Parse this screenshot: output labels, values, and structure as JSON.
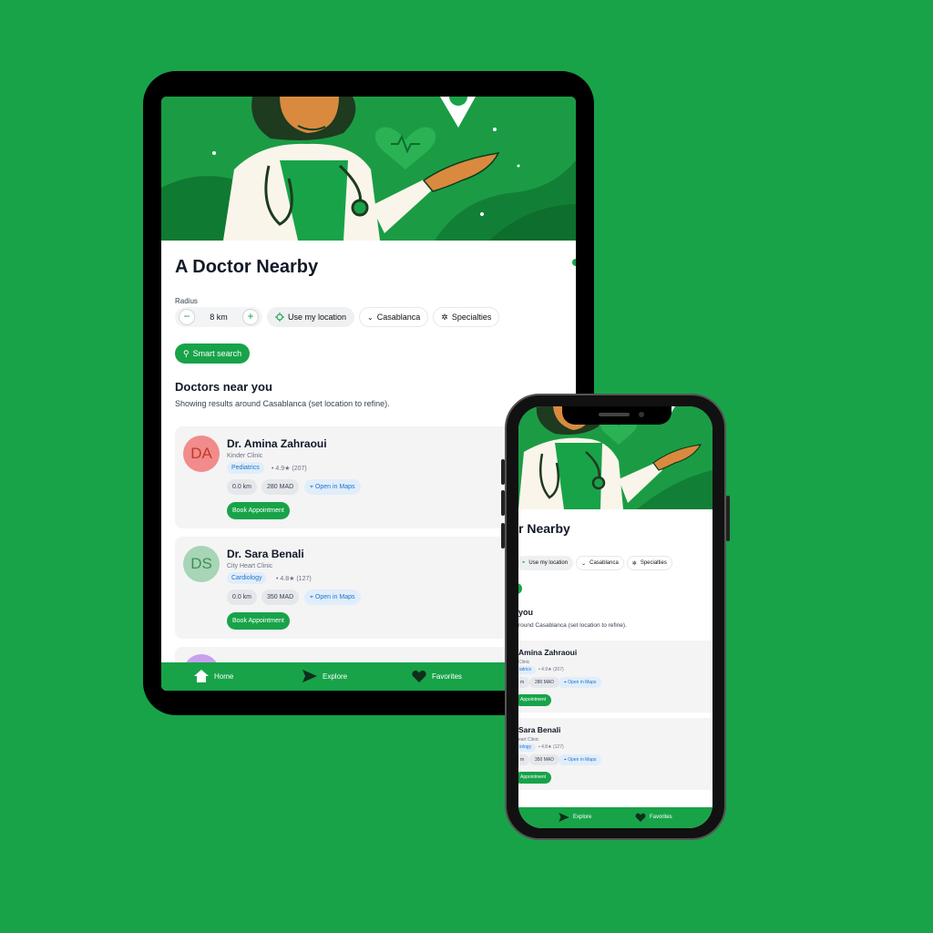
{
  "app": {
    "title": "A Doctor Nearby",
    "title_phone_visible": "r Nearby"
  },
  "filters": {
    "radius_label": "Radius",
    "radius_value": "8 km",
    "minus": "−",
    "plus": "+",
    "use_location": "Use my location",
    "city": "Casablanca",
    "specialties": "Specialties",
    "smart_search": "Smart search"
  },
  "section": {
    "title": "Doctors near you",
    "subtitle": "Showing results around Casablanca (set location to refine).",
    "title_phone_visible": "you",
    "subtitle_phone_visible": "round Casablanca (set location to refine)."
  },
  "doctors": [
    {
      "initials": "DA",
      "name": "Dr. Amina Zahraoui",
      "clinic": "Kinder Clinic",
      "specialty": "Pediatrics",
      "rating": "• 4.9★ (207)",
      "distance": "0.0 km",
      "price": "280 MAD",
      "maps": "Open in Maps",
      "book": "Book Appointment",
      "avatar_bg": "#f28b8b",
      "avatar_fg": "#c0392b",
      "phone_name": "Amina Zahraoui",
      "phone_clinic": "Clinic",
      "phone_specialty": "iatrics",
      "phone_rating": "• 4.9★ (207)",
      "phone_distance": "m",
      "phone_book": "Appointment"
    },
    {
      "initials": "DS",
      "name": "Dr. Sara Benali",
      "clinic": "City Heart Clinic",
      "specialty": "Cardiology",
      "rating": "• 4.8★ (127)",
      "distance": "0.0 km",
      "price": "350 MAD",
      "maps": "Open in Maps",
      "book": "Book Appointment",
      "avatar_bg": "#a8d5b5",
      "avatar_fg": "#3e8e5a",
      "phone_name": "Sara Benali",
      "phone_clinic": "eart Clinic",
      "phone_specialty": "iology",
      "phone_rating": "• 4.8★ (127)",
      "phone_distance": "m",
      "phone_book": "Appointment"
    }
  ],
  "nav": {
    "home": "Home",
    "explore": "Explore",
    "favorites": "Favorites"
  },
  "icons": [
    "home-icon",
    "send-icon",
    "heart-icon",
    "location-target-icon",
    "chevron-down-icon",
    "gear-icon",
    "search-icon",
    "map-pin-icon"
  ],
  "colors": {
    "background": "#18a349",
    "accent": "#18a349",
    "maps_blue": "#1e73c8"
  }
}
